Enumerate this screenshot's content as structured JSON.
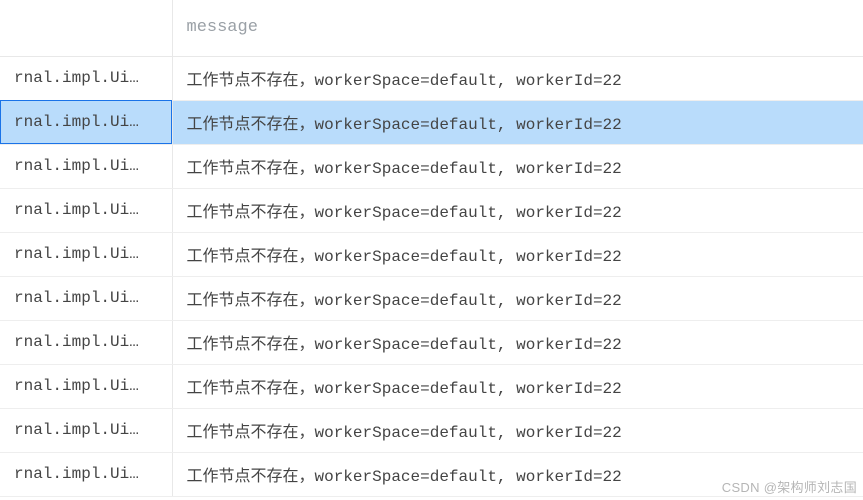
{
  "table": {
    "header": {
      "col1": "",
      "col2": "message"
    },
    "rows": [
      {
        "class": "rnal.impl.Ui…",
        "message": "工作节点不存在，workerSpace=default, workerId=22",
        "selected": false
      },
      {
        "class": "rnal.impl.Ui…",
        "message": "工作节点不存在，workerSpace=default, workerId=22",
        "selected": true
      },
      {
        "class": "rnal.impl.Ui…",
        "message": "工作节点不存在，workerSpace=default, workerId=22",
        "selected": false
      },
      {
        "class": "rnal.impl.Ui…",
        "message": "工作节点不存在，workerSpace=default, workerId=22",
        "selected": false
      },
      {
        "class": "rnal.impl.Ui…",
        "message": "工作节点不存在，workerSpace=default, workerId=22",
        "selected": false
      },
      {
        "class": "rnal.impl.Ui…",
        "message": "工作节点不存在，workerSpace=default, workerId=22",
        "selected": false
      },
      {
        "class": "rnal.impl.Ui…",
        "message": "工作节点不存在，workerSpace=default, workerId=22",
        "selected": false
      },
      {
        "class": "rnal.impl.Ui…",
        "message": "工作节点不存在，workerSpace=default, workerId=22",
        "selected": false
      },
      {
        "class": "rnal.impl.Ui…",
        "message": "工作节点不存在，workerSpace=default, workerId=22",
        "selected": false
      },
      {
        "class": "rnal.impl.Ui…",
        "message": "工作节点不存在，workerSpace=default, workerId=22",
        "selected": false
      }
    ]
  },
  "watermark": "CSDN @架构师刘志国"
}
